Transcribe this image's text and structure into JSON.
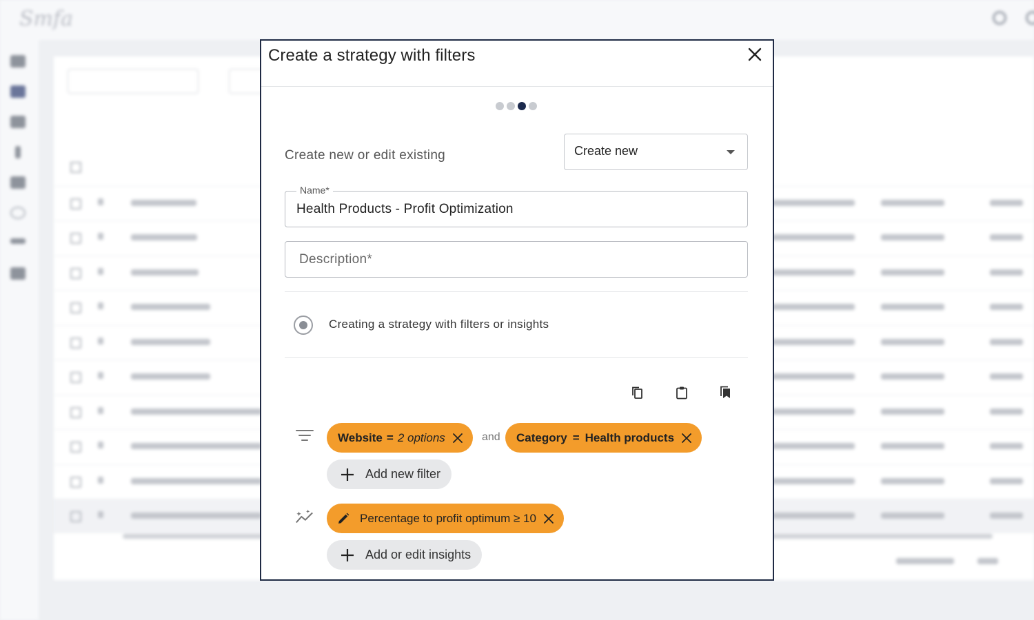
{
  "modal": {
    "title": "Create a strategy with filters",
    "stepper": {
      "total_steps": 4,
      "current_step": 3
    },
    "create_label": "Create new or edit existing",
    "create_select_value": "Create new",
    "name_field": {
      "label": "Name*",
      "value": "Health Products - Profit Optimization"
    },
    "description_field": {
      "placeholder": "Description*"
    },
    "radio_label": "Creating a strategy with filters or insights",
    "toolbar_icons": [
      "copy-icon",
      "clipboard-icon",
      "bookmarks-icon"
    ],
    "filters": [
      {
        "field": "Website",
        "operator": "=",
        "value": "2 options",
        "value_italic": true
      },
      {
        "field": "Category",
        "operator": "=",
        "value": "Health products",
        "value_italic": false
      }
    ],
    "filter_joiner": "and",
    "add_filter_label": "Add new filter",
    "insight": {
      "text": "Percentage to profit optimum ≥ 10"
    },
    "add_insight_label": "Add or edit insights"
  },
  "colors": {
    "chip_orange": "#f39c2b",
    "stepper_active": "#1c2a4d",
    "modal_border": "#1f2a44"
  }
}
